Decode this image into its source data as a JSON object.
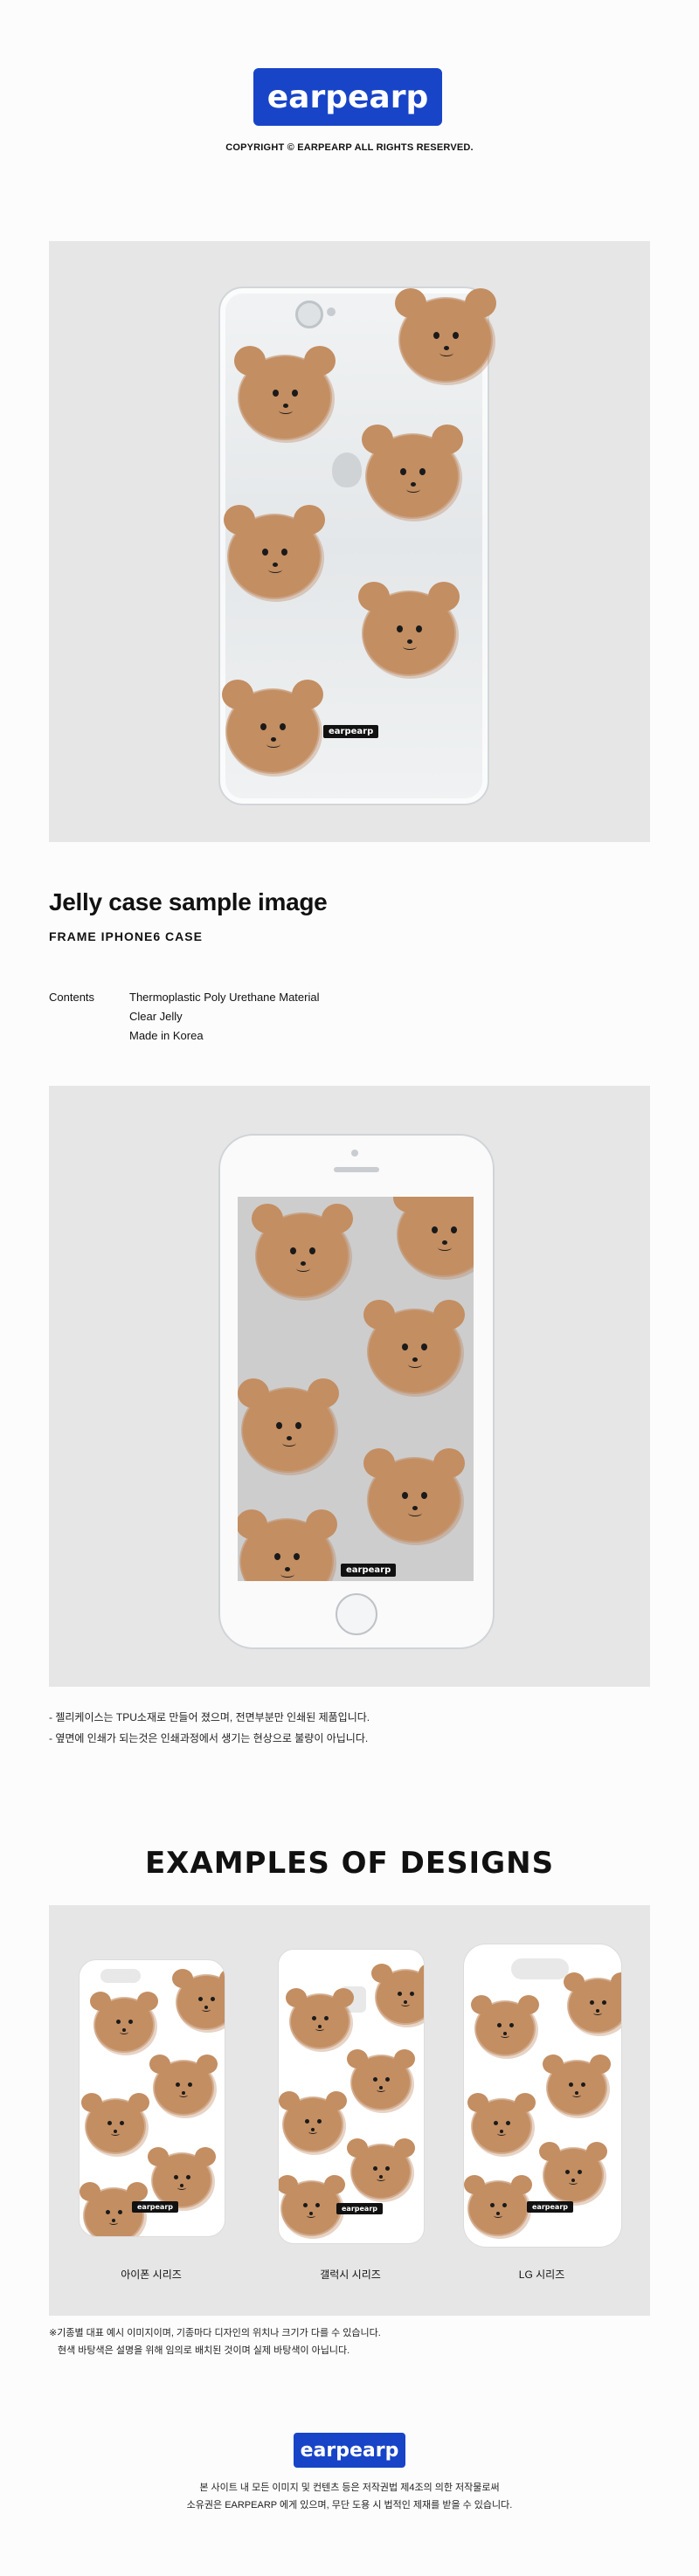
{
  "brand": {
    "logo_text": "earpearp",
    "logo_color": "#1844c8",
    "copyright": "COPYRIGHT © EARPEARP ALL RIGHTS RESERVED."
  },
  "hero": {
    "case_logo": "earpearp"
  },
  "product": {
    "title": "Jelly case sample image",
    "subtitle": "FRAME IPHONE6 CASE",
    "contents_label": "Contents",
    "contents": [
      "Thermoplastic Poly Urethane Material",
      "Clear Jelly",
      "Made in Korea"
    ]
  },
  "preview": {
    "case_logo": "earpearp"
  },
  "notes": [
    "- 젤리케이스는 TPU소재로 만들어 졌으며, 전면부분만 인쇄된 제품입니다.",
    "- 옆면에 인쇄가 되는것은 인쇄과정에서 생기는 현상으로 불량이 아닙니다."
  ],
  "examples": {
    "title": "EXAMPLES OF DESIGNS",
    "items": [
      {
        "caption": "아이폰 시리즈",
        "logo": "earpearp"
      },
      {
        "caption": "갤럭시 시리즈",
        "logo": "earpearp"
      },
      {
        "caption": "LG 시리즈",
        "logo": "earpearp"
      }
    ],
    "disclaimer": [
      "※기종별 대표 예시 이미지이며, 기종마다 디자인의 위치나 크기가 다를 수 있습니다.",
      "현색 바탕색은 설명을 위해 임의로 배치된 것이며 실제 바탕색이 아닙니다."
    ]
  },
  "footer": {
    "logo_text": "earpearp",
    "lines": [
      "본 사이트 내 모든 이미지 및 컨텐츠 등은 저작권법 제4조의 의한 저작물로써",
      "소유권은 EARPEARP 에게 있으며, 무단 도용 시 법적인 제재를 받을 수 있습니다."
    ]
  },
  "colors": {
    "panel": "#e6e6e6",
    "bear": "#c38e62",
    "background": "#fcfcfc"
  }
}
